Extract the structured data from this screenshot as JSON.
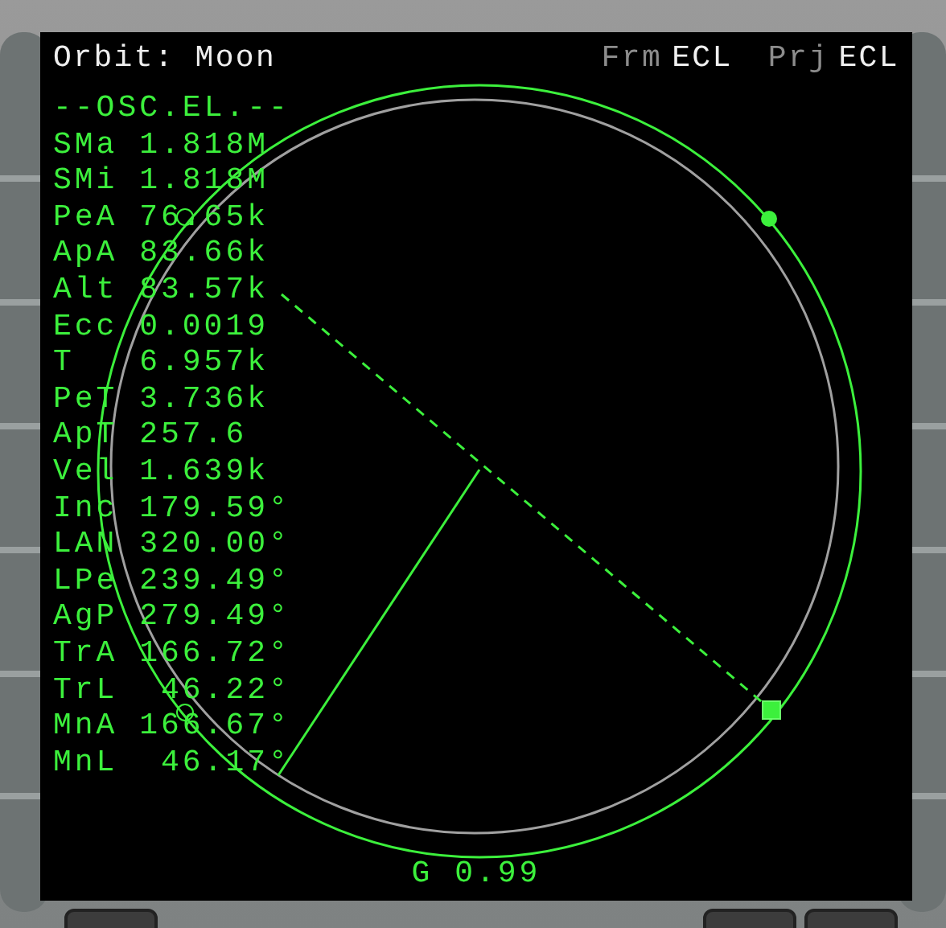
{
  "title": "Orbit: Moon",
  "frame": {
    "label": "Frm",
    "value": "ECL"
  },
  "projection": {
    "label": "Prj",
    "value": "ECL"
  },
  "section_header": "--OSC.EL.--",
  "elements": [
    {
      "label": "SMa",
      "value": "1.818M"
    },
    {
      "label": "SMi",
      "value": "1.818M"
    },
    {
      "label": "PeA",
      "value": "76.65k"
    },
    {
      "label": "ApA",
      "value": "83.66k"
    },
    {
      "label": "Alt",
      "value": "83.57k"
    },
    {
      "label": "Ecc",
      "value": "0.0019"
    },
    {
      "label": "T",
      "value": "6.957k"
    },
    {
      "label": "PeT",
      "value": "3.736k"
    },
    {
      "label": "ApT",
      "value": "257.6"
    },
    {
      "label": "Vel",
      "value": "1.639k"
    },
    {
      "label": "Inc",
      "value": "179.59°"
    },
    {
      "label": "LAN",
      "value": "320.00°"
    },
    {
      "label": "LPe",
      "value": "239.49°"
    },
    {
      "label": "AgP",
      "value": "279.49°"
    },
    {
      "label": "TrA",
      "value": "166.72°"
    },
    {
      "label": "TrL",
      "value": " 46.22°"
    },
    {
      "label": "MnA",
      "value": "166.67°"
    },
    {
      "label": "MnL",
      "value": " 46.17°"
    }
  ],
  "footer": "G 0.99"
}
